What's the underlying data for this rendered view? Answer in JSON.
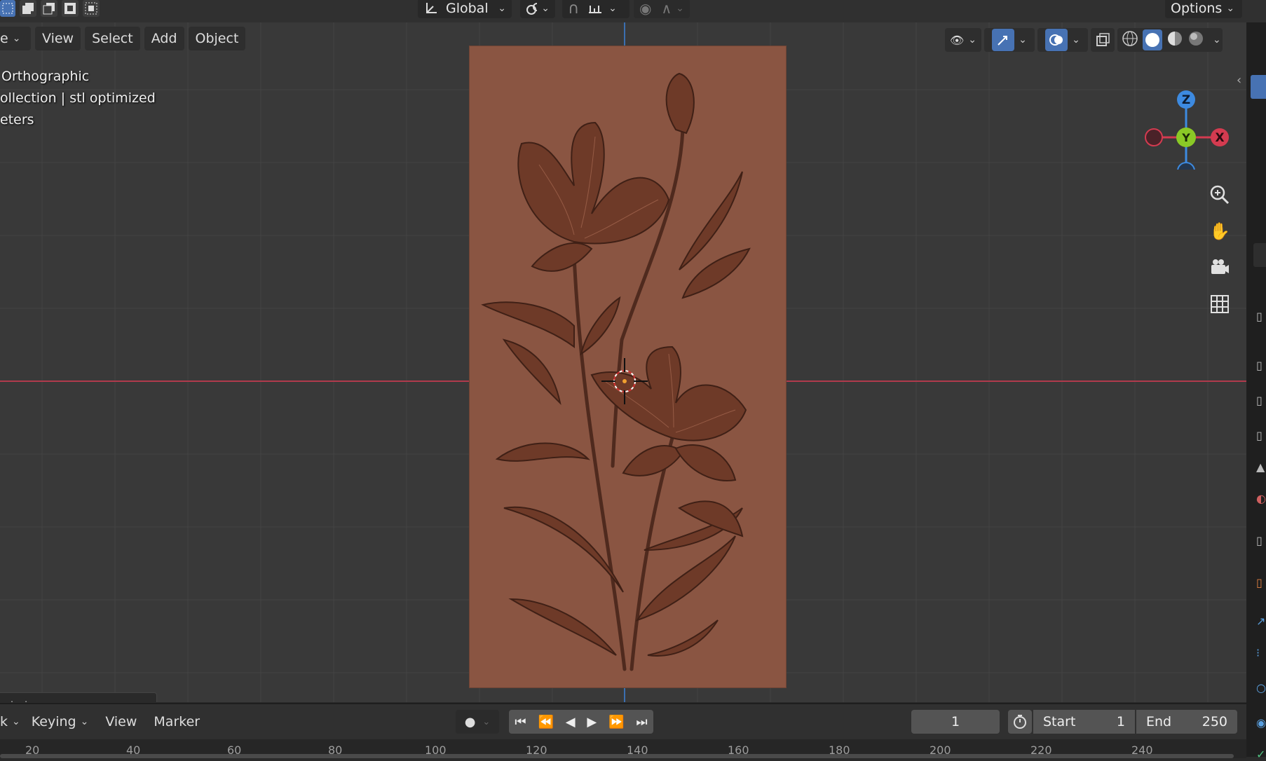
{
  "header": {
    "transform_orientation": "Global",
    "options_label": "Options",
    "select_mode_icons": [
      "select-box-icon",
      "select-extend-icon",
      "select-subtract-icon",
      "select-invert-icon",
      "select-intersect-icon"
    ]
  },
  "viewport": {
    "menu": {
      "mode_label": "e",
      "view": "View",
      "select": "Select",
      "add": "Add",
      "object": "Object"
    },
    "info_lines": [
      "Orthographic",
      "ollection | stl optimized",
      "eters"
    ],
    "operator_panel": "otate",
    "gizmo_axes": {
      "z": "Z",
      "y": "Y",
      "x": "X"
    },
    "colors": {
      "x_axis": "#d43b50",
      "y_axis": "#8ac926",
      "z_axis": "#3d8ae0",
      "active": "#4772b3",
      "panel": "#8a5542"
    }
  },
  "timeline": {
    "playback": "k",
    "keying": "Keying",
    "view": "View",
    "marker": "Marker",
    "current_frame": "1",
    "start_label": "Start",
    "start_value": "1",
    "end_label": "End",
    "end_value": "250",
    "ruler": [
      "20",
      "40",
      "60",
      "80",
      "100",
      "120",
      "140",
      "160",
      "180",
      "200",
      "220",
      "240"
    ]
  }
}
